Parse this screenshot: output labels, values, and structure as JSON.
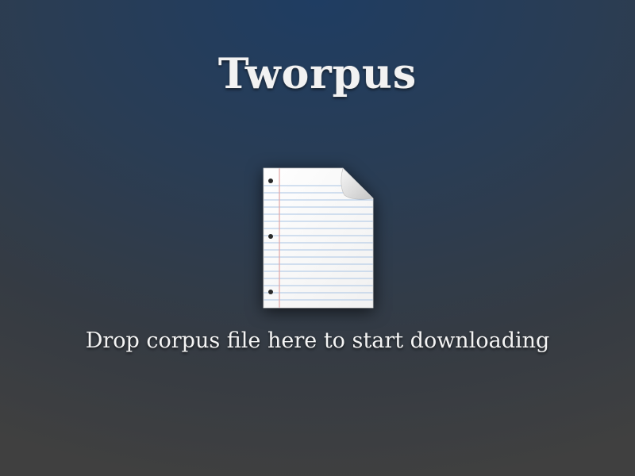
{
  "app": {
    "title": "Tworpus"
  },
  "drop_zone": {
    "icon": "document-icon",
    "hint": "Drop corpus file here to start downloading"
  },
  "colors": {
    "background_top": "#1f3d62",
    "background_bottom": "#404040",
    "text": "#f2f2f2",
    "paper": "#ffffff",
    "rule_lines": "#a9c4e4",
    "margin_line": "#e2a6a6",
    "punch_holes": "#2a2a2a"
  }
}
